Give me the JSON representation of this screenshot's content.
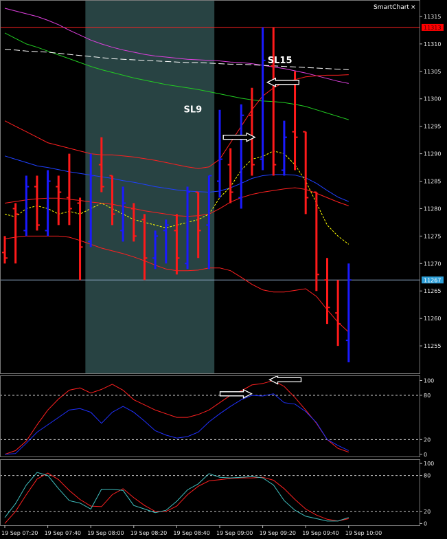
{
  "brand": "SmartChart",
  "close_symbol": "×",
  "colors": {
    "background": "#000000",
    "bull_bar": "#1a1aff",
    "bear_bar": "#ff1a1a",
    "session_shade": "#2f4f4f",
    "hline_red": "#ff2020",
    "hline_price": "#8fa9c8",
    "badge_red": "#ff0000",
    "badge_blue": "#2e9fd8",
    "ema_magenta": "#e040e0",
    "ema_green": "#22cc22",
    "ema_white_dashed": "#ffffff",
    "channel_red": "#ff2020",
    "channel_blue": "#2040ff",
    "signal_yellow": "#ffff00",
    "osc1_red": "#ff2020",
    "osc1_blue": "#2030ff",
    "osc2_red": "#ff2020",
    "osc2_cyan": "#40c0c0"
  },
  "chart_data": [
    {
      "type": "candlestick",
      "panel": "price",
      "ylim": [
        11250,
        11318
      ],
      "yticks": [
        11255,
        11260,
        11265,
        11270,
        11275,
        11280,
        11285,
        11290,
        11295,
        11300,
        11305,
        11310,
        11315
      ],
      "x_labels": [
        "19 Sep 07:20",
        "19 Sep 07:40",
        "19 Sep 08:00",
        "19 Sep 08:20",
        "19 Sep 08:40",
        "19 Sep 09:00",
        "19 Sep 09:20",
        "19 Sep 09:40",
        "19 Sep 10:00"
      ],
      "x_label_bar_index": [
        0,
        4,
        8,
        12,
        16,
        20,
        24,
        28,
        32
      ],
      "bar_count": 33,
      "session_shade_bars": [
        7.5,
        19.5
      ],
      "bars": [
        {
          "o": 11272,
          "h": 11275,
          "l": 11270,
          "c": 11271
        },
        {
          "o": 11280,
          "h": 11281,
          "l": 11270,
          "c": 11279
        },
        {
          "o": 11276,
          "h": 11286,
          "l": 11275,
          "c": 11284
        },
        {
          "o": 11284,
          "h": 11286,
          "l": 11276,
          "c": 11277
        },
        {
          "o": 11276,
          "h": 11287,
          "l": 11275,
          "c": 11285
        },
        {
          "o": 11284,
          "h": 11286,
          "l": 11277,
          "c": 11283
        },
        {
          "o": 11282,
          "h": 11290,
          "l": 11277,
          "c": 11280
        },
        {
          "o": 11281,
          "h": 11282,
          "l": 11267,
          "c": 11273
        },
        {
          "o": 11274,
          "h": 11290,
          "l": 11273,
          "c": 11286
        },
        {
          "o": 11288,
          "h": 11293,
          "l": 11283,
          "c": 11284
        },
        {
          "o": 11286,
          "h": 11286,
          "l": 11277,
          "c": 11279
        },
        {
          "o": 11276,
          "h": 11284,
          "l": 11274,
          "c": 11281
        },
        {
          "o": 11280,
          "h": 11281,
          "l": 11274,
          "c": 11275
        },
        {
          "o": 11278,
          "h": 11279,
          "l": 11267,
          "c": 11271
        },
        {
          "o": 11271,
          "h": 11276,
          "l": 11269,
          "c": 11275
        },
        {
          "o": 11276,
          "h": 11278,
          "l": 11270,
          "c": 11277
        },
        {
          "o": 11276,
          "h": 11279,
          "l": 11268,
          "c": 11271
        },
        {
          "o": 11270,
          "h": 11284,
          "l": 11269,
          "c": 11283
        },
        {
          "o": 11283,
          "h": 11283,
          "l": 11271,
          "c": 11276
        },
        {
          "o": 11277,
          "h": 11286,
          "l": 11269,
          "c": 11286
        },
        {
          "o": 11285,
          "h": 11298,
          "l": 11282,
          "c": 11289
        },
        {
          "o": 11288,
          "h": 11291,
          "l": 11281,
          "c": 11283
        },
        {
          "o": 11282,
          "h": 11299,
          "l": 11280,
          "c": 11297
        },
        {
          "o": 11297,
          "h": 11302,
          "l": 11286,
          "c": 11288
        },
        {
          "o": 11289,
          "h": 11313,
          "l": 11287,
          "c": 11307
        },
        {
          "o": 11306,
          "h": 11313,
          "l": 11286,
          "c": 11288
        },
        {
          "o": 11287,
          "h": 11296,
          "l": 11286,
          "c": 11293
        },
        {
          "o": 11294,
          "h": 11305,
          "l": 11287,
          "c": 11293
        },
        {
          "o": 11294,
          "h": 11287,
          "l": 11279,
          "c": 11282
        },
        {
          "o": 11283,
          "h": 11280,
          "l": 11265,
          "c": 11268
        },
        {
          "o": 11267,
          "h": 11271,
          "l": 11259,
          "c": 11262
        },
        {
          "o": 11261,
          "h": 11267,
          "l": 11255,
          "c": 11259
        },
        {
          "o": 11256,
          "h": 11270,
          "l": 11252,
          "c": 11267
        }
      ],
      "hlines": [
        {
          "value": 11313,
          "label": "11313",
          "color_key": "hline_red",
          "badge_key": "badge_red"
        },
        {
          "value": 11267,
          "label": "11267",
          "color_key": "hline_price",
          "badge_key": "badge_blue"
        }
      ],
      "lines": [
        {
          "color_key": "ema_magenta",
          "dash": "",
          "values": [
            11316.5,
            11316,
            11315.5,
            11315,
            11314.3,
            11313.5,
            11312.5,
            11311.6,
            11310.7,
            11310,
            11309.4,
            11308.9,
            11308.5,
            11308.1,
            11307.8,
            11307.6,
            11307.4,
            11307.2,
            11307.1,
            11307,
            11306.9,
            11306.7,
            11306.6,
            11306.4,
            11306.1,
            11305.8,
            11305.5,
            11305.1,
            11304.7,
            11304.2,
            11303.7,
            11303.2,
            11302.8
          ]
        },
        {
          "color_key": "ema_green",
          "dash": "",
          "values": [
            11312,
            11311,
            11310,
            11309.4,
            11308.7,
            11308,
            11307.3,
            11306.6,
            11305.9,
            11305.3,
            11304.8,
            11304.3,
            11303.8,
            11303.4,
            11303,
            11302.6,
            11302.3,
            11302,
            11301.7,
            11301.3,
            11300.9,
            11300.5,
            11300.1,
            11299.8,
            11299.6,
            11299.5,
            11299.3,
            11299,
            11298.6,
            11298,
            11297.4,
            11296.8,
            11296.2
          ]
        },
        {
          "color_key": "ema_white_dashed",
          "dash": "9 4",
          "values": [
            11309,
            11308.9,
            11308.7,
            11308.6,
            11308.5,
            11308.3,
            11308.1,
            11307.9,
            11307.7,
            11307.5,
            11307.3,
            11307.2,
            11307.1,
            11307,
            11306.9,
            11306.8,
            11306.7,
            11306.6,
            11306.6,
            11306.5,
            11306.4,
            11306.3,
            11306.3,
            11306.2,
            11306.1,
            11306,
            11305.9,
            11305.8,
            11305.7,
            11305.6,
            11305.5,
            11305.4,
            11305.3
          ]
        },
        {
          "color_key": "channel_red",
          "dash": "",
          "values": [
            11296,
            11295,
            11294,
            11293,
            11292,
            11291.5,
            11291,
            11290.5,
            11290,
            11289.8,
            11289.8,
            11289.6,
            11289.4,
            11289.1,
            11288.8,
            11288.4,
            11288,
            11287.6,
            11287.3,
            11287.6,
            11289,
            11292,
            11295,
            11298,
            11300.5,
            11302,
            11303,
            11303.5,
            11304,
            11304.2,
            11304.3,
            11304.3,
            11304.4
          ]
        },
        {
          "color_key": "channel_red",
          "dash": "",
          "values": [
            11281,
            11281.3,
            11281.6,
            11281.8,
            11281.9,
            11281.9,
            11281.7,
            11281.5,
            11281.2,
            11281,
            11280.8,
            11280.4,
            11280,
            11279.6,
            11279.3,
            11279,
            11278.7,
            11278.6,
            11278.7,
            11279,
            11280,
            11281.2,
            11282,
            11282.6,
            11283,
            11283.3,
            11283.6,
            11283.8,
            11283.5,
            11282.8,
            11282,
            11281.2,
            11280.5
          ]
        },
        {
          "color_key": "channel_red",
          "dash": "",
          "values": [
            11274.5,
            11274.8,
            11275,
            11275,
            11275,
            11275,
            11274.8,
            11274.2,
            11273.5,
            11272.8,
            11272.3,
            11271.8,
            11271.2,
            11270.5,
            11269.7,
            11269,
            11268.7,
            11268.7,
            11268.8,
            11269.2,
            11269.2,
            11268.7,
            11267.5,
            11266.2,
            11265.2,
            11264.8,
            11264.8,
            11265.1,
            11265.4,
            11264,
            11261.6,
            11259.3,
            11257.5
          ]
        },
        {
          "color_key": "channel_blue",
          "dash": "",
          "values": [
            11289.6,
            11289,
            11288.4,
            11287.8,
            11287.5,
            11287.1,
            11286.7,
            11286.4,
            11286.1,
            11285.8,
            11285.5,
            11285.1,
            11284.8,
            11284.4,
            11284,
            11283.7,
            11283.4,
            11283.2,
            11283.1,
            11283,
            11283.2,
            11283.8,
            11284.6,
            11285.5,
            11286,
            11286.2,
            11286.2,
            11286.1,
            11285.6,
            11284.6,
            11283.3,
            11282.1,
            11281.3
          ]
        },
        {
          "color_key": "signal_yellow",
          "dash": "3 2",
          "values": [
            11279,
            11278.5,
            11280,
            11280.5,
            11280,
            11279,
            11279.5,
            11279,
            11280,
            11281,
            11280,
            11279,
            11278,
            11277.5,
            11277,
            11276.5,
            11277,
            11277.5,
            11278,
            11279,
            11282,
            11284,
            11287,
            11289,
            11289.5,
            11290.5,
            11290,
            11288,
            11285,
            11281,
            11277,
            11275,
            11273.5
          ]
        }
      ],
      "annotations": [
        {
          "text": "SL9",
          "bar": 17.5,
          "value": 11297.5
        },
        {
          "text": "SL15",
          "bar": 25.6,
          "value": 11306.5
        }
      ],
      "arrows": [
        {
          "direction": "right",
          "bar": 21.8,
          "value": 11293
        },
        {
          "direction": "left",
          "bar": 25.9,
          "value": 11303
        }
      ]
    },
    {
      "type": "line",
      "panel": "oscillator-1",
      "ylim": [
        -3,
        107
      ],
      "yticks": [
        0,
        20,
        80,
        100
      ],
      "levels": [
        20,
        80
      ],
      "series": [
        {
          "color_key": "osc1_red",
          "values": [
            0,
            5,
            18,
            40,
            60,
            75,
            87,
            90,
            83,
            88,
            95,
            87,
            74,
            67,
            60,
            55,
            50,
            50,
            54,
            60,
            70,
            80,
            86,
            94,
            96,
            100,
            92,
            77,
            60,
            42,
            20,
            8,
            3
          ]
        },
        {
          "color_key": "osc1_blue",
          "values": [
            0,
            1,
            15,
            30,
            40,
            50,
            60,
            62,
            57,
            42,
            57,
            65,
            57,
            45,
            32,
            26,
            22,
            24,
            30,
            44,
            55,
            65,
            74,
            80,
            79,
            82,
            70,
            68,
            58,
            43,
            20,
            12,
            5
          ]
        }
      ],
      "arrows": [
        {
          "direction": "right",
          "bar": 21.5,
          "value": 82
        },
        {
          "direction": "left",
          "bar": 26.1,
          "value": 101
        }
      ]
    },
    {
      "type": "line",
      "panel": "oscillator-2",
      "ylim": [
        -3,
        107
      ],
      "yticks": [
        0,
        20,
        80,
        100
      ],
      "levels": [
        20,
        80
      ],
      "series": [
        {
          "color_key": "osc2_red",
          "values": [
            0,
            20,
            48,
            74,
            84,
            73,
            55,
            40,
            29,
            28,
            48,
            58,
            43,
            30,
            20,
            20,
            29,
            48,
            62,
            71,
            73,
            75,
            76,
            76,
            77,
            72,
            58,
            40,
            24,
            14,
            7,
            4,
            8
          ]
        },
        {
          "color_key": "osc2_cyan",
          "values": [
            10,
            33,
            64,
            85,
            80,
            58,
            38,
            34,
            24,
            57,
            57,
            55,
            30,
            24,
            18,
            22,
            37,
            56,
            66,
            83,
            77,
            76,
            77,
            78,
            76,
            64,
            38,
            22,
            12,
            8,
            4,
            4,
            10
          ]
        }
      ]
    }
  ]
}
